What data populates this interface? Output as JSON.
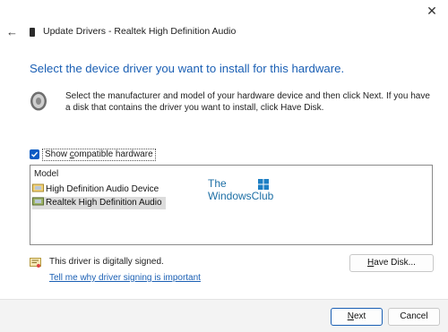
{
  "window": {
    "close_glyph": "✕",
    "back_glyph": "←",
    "title": "Update Drivers - Realtek High Definition Audio"
  },
  "main": {
    "heading": "Select the device driver you want to install for this hardware.",
    "description": "Select the manufacturer and model of your hardware device and then click Next. If you have a disk that contains the driver you want to install, click Have Disk.",
    "show_compatible": {
      "prefix": "Show ",
      "accel": "c",
      "suffix": "ompatible hardware",
      "checked": true
    },
    "list": {
      "header": "Model",
      "items": [
        {
          "label": "High Definition Audio Device",
          "selected": false,
          "icon": "driver-icon"
        },
        {
          "label": "Realtek High Definition Audio",
          "selected": true,
          "icon": "driver-icon"
        }
      ]
    },
    "watermark": {
      "line1": "The",
      "line2": "WindowsClub"
    },
    "signed_text": "This driver is digitally signed.",
    "why_link": "Tell me why driver signing is important",
    "have_disk": {
      "accel": "H",
      "rest": "ave Disk..."
    }
  },
  "footer": {
    "next": {
      "accel": "N",
      "rest": "ext"
    },
    "cancel": "Cancel"
  },
  "colors": {
    "accent": "#1a5fb4",
    "checkbox": "#0a5bc4",
    "footer_bg": "#f3f3f3"
  }
}
